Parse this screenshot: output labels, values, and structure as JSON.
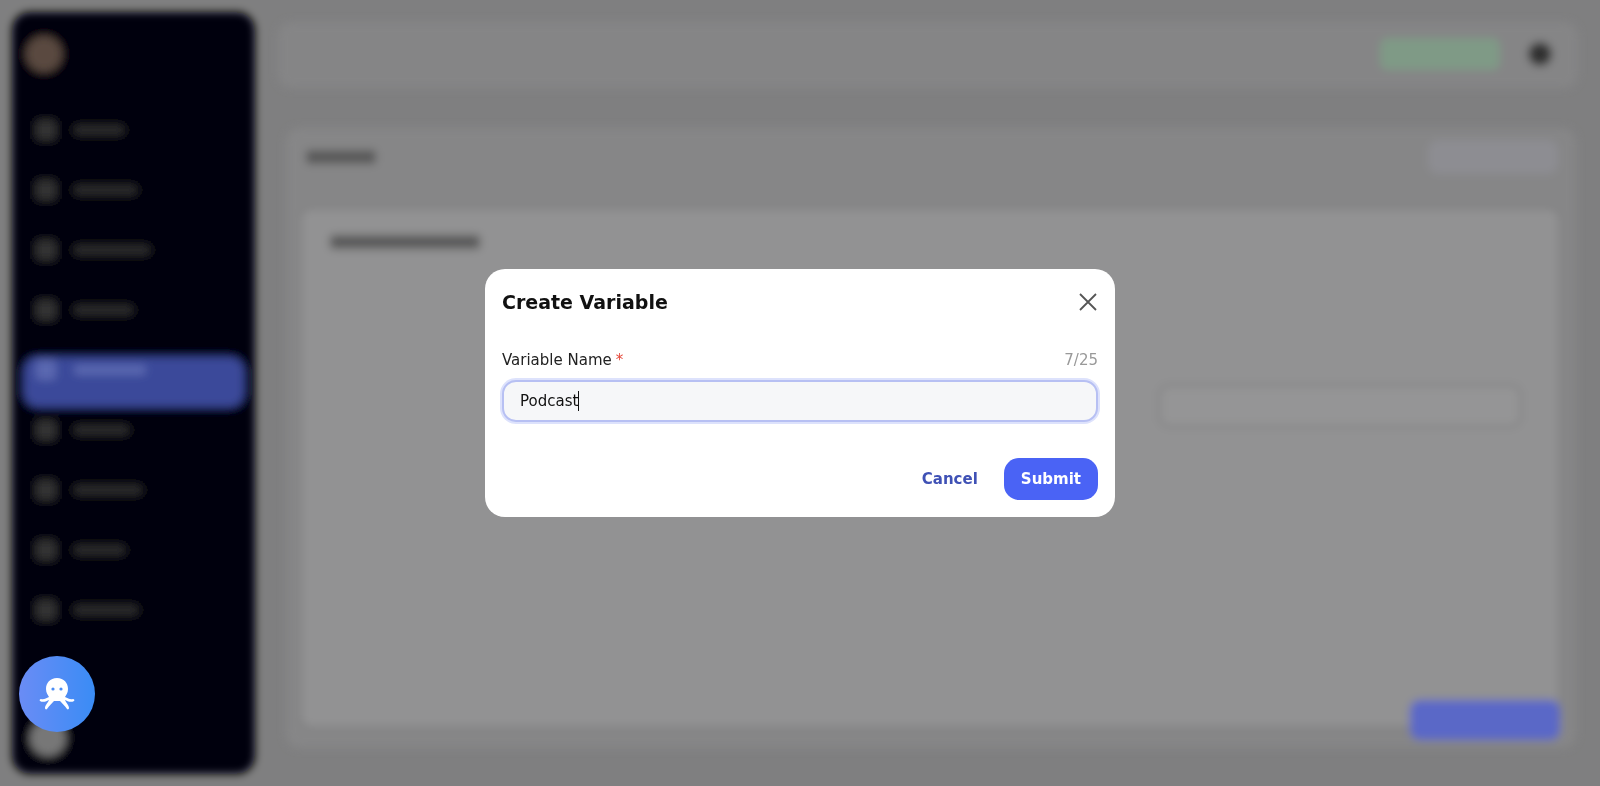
{
  "dialog": {
    "title": "Create Variable",
    "field": {
      "label": "Variable Name",
      "required_mark": "*",
      "counter": "7/25",
      "value": "Podcast",
      "focused": true
    },
    "buttons": [
      {
        "label": "Cancel",
        "kind": "text"
      },
      {
        "label": "Submit",
        "kind": "primary"
      }
    ]
  }
}
